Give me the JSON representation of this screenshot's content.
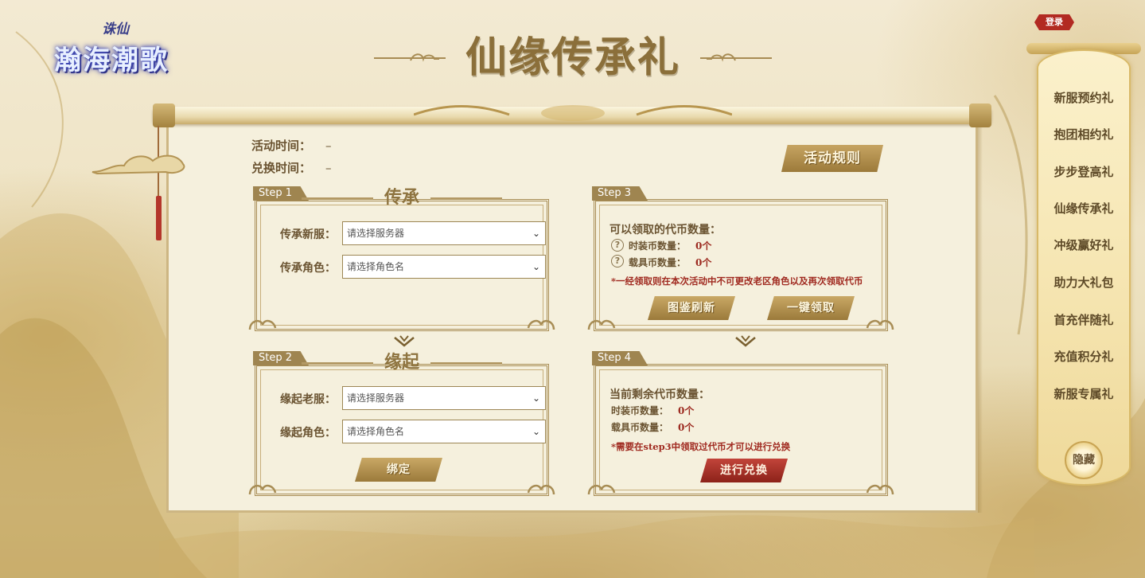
{
  "logo": {
    "main": "瀚海潮歌",
    "small": "诛仙"
  },
  "header": {
    "login_label": "登录",
    "title": "仙缘传承礼"
  },
  "info": {
    "activity_time_label": "活动时间：",
    "activity_time_value": "–",
    "exchange_time_label": "兑换时间：",
    "exchange_time_value": "–",
    "rules_label": "活动规则"
  },
  "step1": {
    "tag": "Step 1",
    "heading": "传承",
    "server_label": "传承新服：",
    "server_placeholder": "请选择服务器",
    "role_label": "传承角色：",
    "role_placeholder": "请选择角色名"
  },
  "step2": {
    "tag": "Step 2",
    "heading": "缘起",
    "server_label": "缘起老服：",
    "server_placeholder": "请选择服务器",
    "role_label": "缘起角色：",
    "role_placeholder": "请选择角色名",
    "bind_label": "绑定"
  },
  "step3": {
    "tag": "Step 3",
    "title": "可以领取的代币数量：",
    "fashion_label": "时装币数量：",
    "fashion_value": "0个",
    "mount_label": "载具币数量：",
    "mount_value": "0个",
    "note": "*一经领取则在本次活动中不可更改老区角色以及再次领取代币",
    "refresh_label": "图鉴刷新",
    "claim_label": "一键领取"
  },
  "step4": {
    "tag": "Step 4",
    "title": "当前剩余代币数量：",
    "fashion_label": "时装币数量：",
    "fashion_value": "0个",
    "mount_label": "载具币数量：",
    "mount_value": "0个",
    "note": "*需要在step3中领取过代币才可以进行兑换",
    "exchange_label": "进行兑换"
  },
  "sidebar": {
    "items": [
      {
        "label": "新服预约礼"
      },
      {
        "label": "抱团相约礼"
      },
      {
        "label": "步步登高礼"
      },
      {
        "label": "仙缘传承礼"
      },
      {
        "label": "冲级赢好礼"
      },
      {
        "label": "助力大礼包"
      },
      {
        "label": "首充伴随礼"
      },
      {
        "label": "充值积分礼"
      },
      {
        "label": "新服专属礼"
      }
    ],
    "hide_label": "隐藏"
  },
  "colors": {
    "gold": "#9f8550",
    "red": "#a02a20",
    "panel": "#f5f0dd"
  }
}
